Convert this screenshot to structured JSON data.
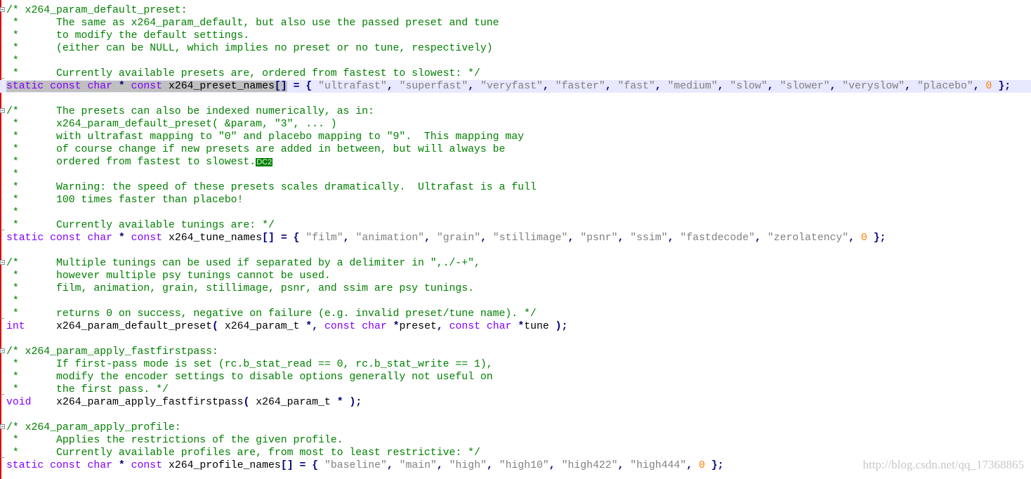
{
  "editor": {
    "colors": {
      "comment": "#008000",
      "keyword": "#8000ff",
      "string": "#808080",
      "number": "#ff8000",
      "operator": "#000080",
      "current_line": "#e8e8ff",
      "selection": "#c0c0c0"
    },
    "current_line": 6,
    "selection": {
      "line": 6,
      "length": 45
    },
    "fold_starts": [
      0,
      8,
      20,
      27,
      33
    ],
    "fold_ends": [
      5,
      17,
      24,
      30,
      35
    ],
    "lines": [
      {
        "kind": "comment",
        "text": "/* x264_param_default_preset:"
      },
      {
        "kind": "comment",
        "text": " *      The same as x264_param_default, but also use the passed preset and tune"
      },
      {
        "kind": "comment",
        "text": " *      to modify the default settings."
      },
      {
        "kind": "comment",
        "text": " *      (either can be NULL, which implies no preset or no tune, respectively)"
      },
      {
        "kind": "comment",
        "text": " *"
      },
      {
        "kind": "comment",
        "text": " *      Currently available presets are, ordered from fastest to slowest: */"
      },
      {
        "kind": "code",
        "text": "static const char * const x264_preset_names[] = { \"ultrafast\", \"superfast\", \"veryfast\", \"faster\", \"fast\", \"medium\", \"slow\", \"slower\", \"veryslow\", \"placebo\", 0 };"
      },
      {
        "kind": "code",
        "text": ""
      },
      {
        "kind": "comment",
        "text": "/*      The presets can also be indexed numerically, as in:"
      },
      {
        "kind": "comment",
        "text": " *      x264_param_default_preset( &param, \"3\", ... )"
      },
      {
        "kind": "comment",
        "text": " *      with ultrafast mapping to \"0\" and placebo mapping to \"9\".  This mapping may"
      },
      {
        "kind": "comment",
        "text": " *      of course change if new presets are added in between, but will always be"
      },
      {
        "kind": "comment",
        "text": " *      ordered from fastest to slowest.",
        "ctrl": "DC2"
      },
      {
        "kind": "comment",
        "text": " *"
      },
      {
        "kind": "comment",
        "text": " *      Warning: the speed of these presets scales dramatically.  Ultrafast is a full"
      },
      {
        "kind": "comment",
        "text": " *      100 times faster than placebo!"
      },
      {
        "kind": "comment",
        "text": " *"
      },
      {
        "kind": "comment",
        "text": " *      Currently available tunings are: */"
      },
      {
        "kind": "code",
        "text": "static const char * const x264_tune_names[] = { \"film\", \"animation\", \"grain\", \"stillimage\", \"psnr\", \"ssim\", \"fastdecode\", \"zerolatency\", 0 };"
      },
      {
        "kind": "code",
        "text": ""
      },
      {
        "kind": "comment",
        "text": "/*      Multiple tunings can be used if separated by a delimiter in \",./-+\","
      },
      {
        "kind": "comment",
        "text": " *      however multiple psy tunings cannot be used."
      },
      {
        "kind": "comment",
        "text": " *      film, animation, grain, stillimage, psnr, and ssim are psy tunings."
      },
      {
        "kind": "comment",
        "text": " *"
      },
      {
        "kind": "comment",
        "text": " *      returns 0 on success, negative on failure (e.g. invalid preset/tune name). */"
      },
      {
        "kind": "code",
        "text": "int     x264_param_default_preset( x264_param_t *, const char *preset, const char *tune );"
      },
      {
        "kind": "code",
        "text": ""
      },
      {
        "kind": "comment",
        "text": "/* x264_param_apply_fastfirstpass:"
      },
      {
        "kind": "comment",
        "text": " *      If first-pass mode is set (rc.b_stat_read == 0, rc.b_stat_write == 1),"
      },
      {
        "kind": "comment",
        "text": " *      modify the encoder settings to disable options generally not useful on"
      },
      {
        "kind": "comment",
        "text": " *      the first pass. */"
      },
      {
        "kind": "code",
        "text": "void    x264_param_apply_fastfirstpass( x264_param_t * );"
      },
      {
        "kind": "code",
        "text": ""
      },
      {
        "kind": "comment",
        "text": "/* x264_param_apply_profile:"
      },
      {
        "kind": "comment",
        "text": " *      Applies the restrictions of the given profile."
      },
      {
        "kind": "comment",
        "text": " *      Currently available profiles are, from most to least restrictive: */"
      },
      {
        "kind": "code",
        "text": "static const char * const x264_profile_names[] = { \"baseline\", \"main\", \"high\", \"high10\", \"high422\", \"high444\", 0 };"
      }
    ]
  },
  "watermark": "http://blog.csdn.net/qq_17368865"
}
